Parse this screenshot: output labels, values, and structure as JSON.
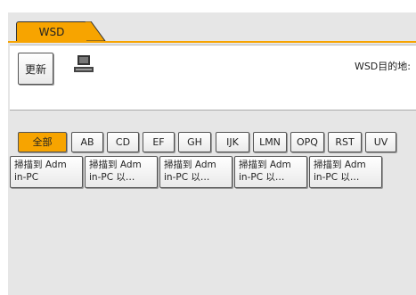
{
  "tab": {
    "label": "WSD"
  },
  "toolbar": {
    "refresh_label": "更新",
    "destination_label": "WSD目的地:"
  },
  "alpha_tabs": [
    "全部",
    "AB",
    "CD",
    "EF",
    "GH",
    "IJK",
    "LMN",
    "OPQ",
    "RST",
    "UV"
  ],
  "alpha_selected": "全部",
  "entries": [
    {
      "line1": "掃描到 Adm",
      "line2": "in-PC"
    },
    {
      "line1": "掃描到 Adm",
      "line2": "in-PC 以…"
    },
    {
      "line1": "掃描到 Adm",
      "line2": "in-PC 以…"
    },
    {
      "line1": "掃描到 Adm",
      "line2": "in-PC 以…"
    },
    {
      "line1": "掃描到 Adm",
      "line2": "in-PC 以…"
    }
  ],
  "colors": {
    "accent": "#f7a400",
    "panel": "#e6e6e6"
  }
}
